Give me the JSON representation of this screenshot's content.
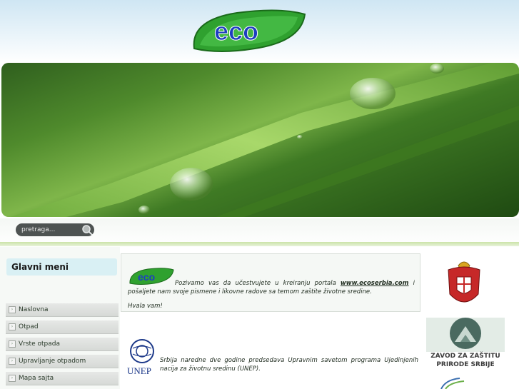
{
  "header": {
    "logo_text": "eco"
  },
  "search": {
    "placeholder": "pretraga..."
  },
  "sidebar": {
    "title": "Glavni meni",
    "items": [
      {
        "label": "Naslovna"
      },
      {
        "label": "Otpad"
      },
      {
        "label": "Vrste otpada"
      },
      {
        "label": "Upravljanje otpadom"
      },
      {
        "label": "Mapa sajta"
      }
    ]
  },
  "content": {
    "intro_text_before": "Pozivamo vas da učestvujete u kreiranju portala ",
    "intro_link": "www.ecoserbia.com",
    "intro_text_after": " i pošaljete nam svoje pismene i likovne radove sa temom zaštite životne sredine.",
    "thanks": "Hvala vam!",
    "unep_label": "UNEP",
    "unep_text": "Srbija naredne dve godine predsedava Upravnim savetom programa Ujedinjenih nacija za životnu sredinu (UNEP)."
  },
  "right": {
    "zavod_line1": "ZAVOD ZA ZAŠTITU",
    "zavod_line2": "PRIRODE SRBIJE"
  },
  "colors": {
    "accent_green": "#2e8b2e",
    "banner_green": "#4f8a2c"
  }
}
